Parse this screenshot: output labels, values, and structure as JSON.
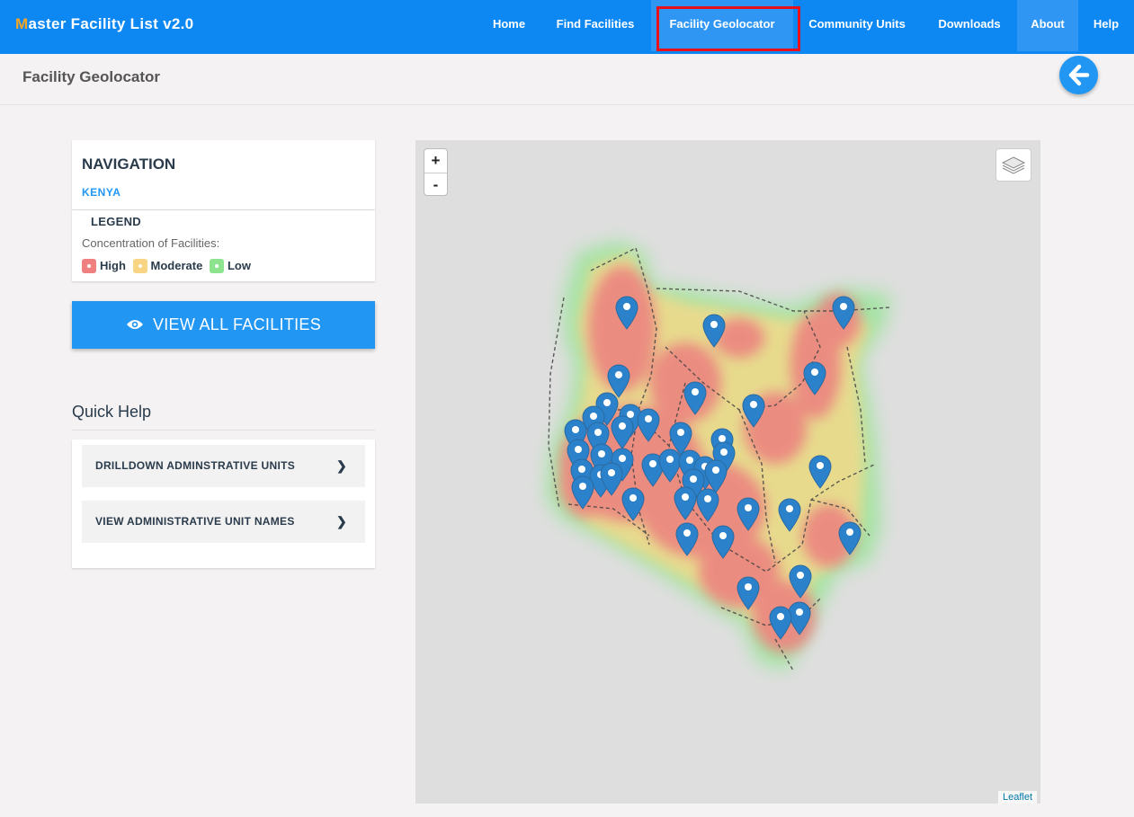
{
  "app": {
    "brand_first": "M",
    "brand_rest": "aster Facility List v2.0"
  },
  "nav": {
    "items": [
      {
        "label": "Home"
      },
      {
        "label": "Find Facilities"
      },
      {
        "label": "Facility Geolocator"
      },
      {
        "label": "Community Units"
      },
      {
        "label": "Downloads"
      },
      {
        "label": "About"
      },
      {
        "label": "Help"
      }
    ]
  },
  "page": {
    "title": "Facility Geolocator"
  },
  "navigation_panel": {
    "heading": "NAVIGATION",
    "link": "KENYA"
  },
  "legend": {
    "title": "LEGEND",
    "subtitle": "Concentration of Facilities:",
    "items": [
      {
        "label": "High",
        "color": "#f08080"
      },
      {
        "label": "Moderate",
        "color": "#f8d582"
      },
      {
        "label": "Low",
        "color": "#8ee48e"
      }
    ]
  },
  "actions": {
    "view_all": "VIEW ALL FACILITIES"
  },
  "quick_help": {
    "title": "Quick Help",
    "items": [
      {
        "label": "DRILLDOWN ADMINSTRATIVE UNITS"
      },
      {
        "label": "VIEW ADMINISTRATIVE UNIT NAMES"
      }
    ]
  },
  "map": {
    "zoom_in": "+",
    "zoom_out": "-",
    "attribution": "Leaflet"
  },
  "colors": {
    "primary": "#0d87f2",
    "accent": "#2196f3",
    "brand_initial": "#f5a623",
    "highlight_box": "#e8101b"
  },
  "icons": {
    "back": "arrow-left-icon",
    "eye": "eye-icon",
    "layers": "layers-icon",
    "chevron": "chevron-right-icon",
    "pin": "map-marker-icon"
  }
}
